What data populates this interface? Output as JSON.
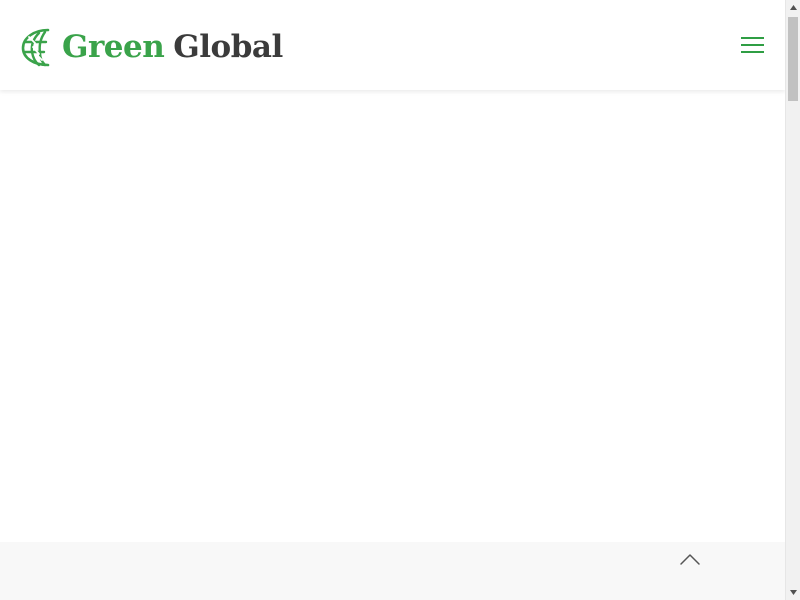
{
  "header": {
    "logo_word_1": "Green",
    "logo_word_2": "Global",
    "logo_icon": "globe-logo-icon",
    "menu_icon": "hamburger-menu-icon"
  },
  "footer": {
    "back_to_top_icon": "chevron-up-icon"
  },
  "scrollbar": {
    "position_fraction": 0.0
  },
  "colors": {
    "brand_green": "#3aa34a",
    "brand_dark": "#3b3b3b",
    "menu_green": "#2f9e44",
    "footer_band": "#f8f8f8"
  }
}
